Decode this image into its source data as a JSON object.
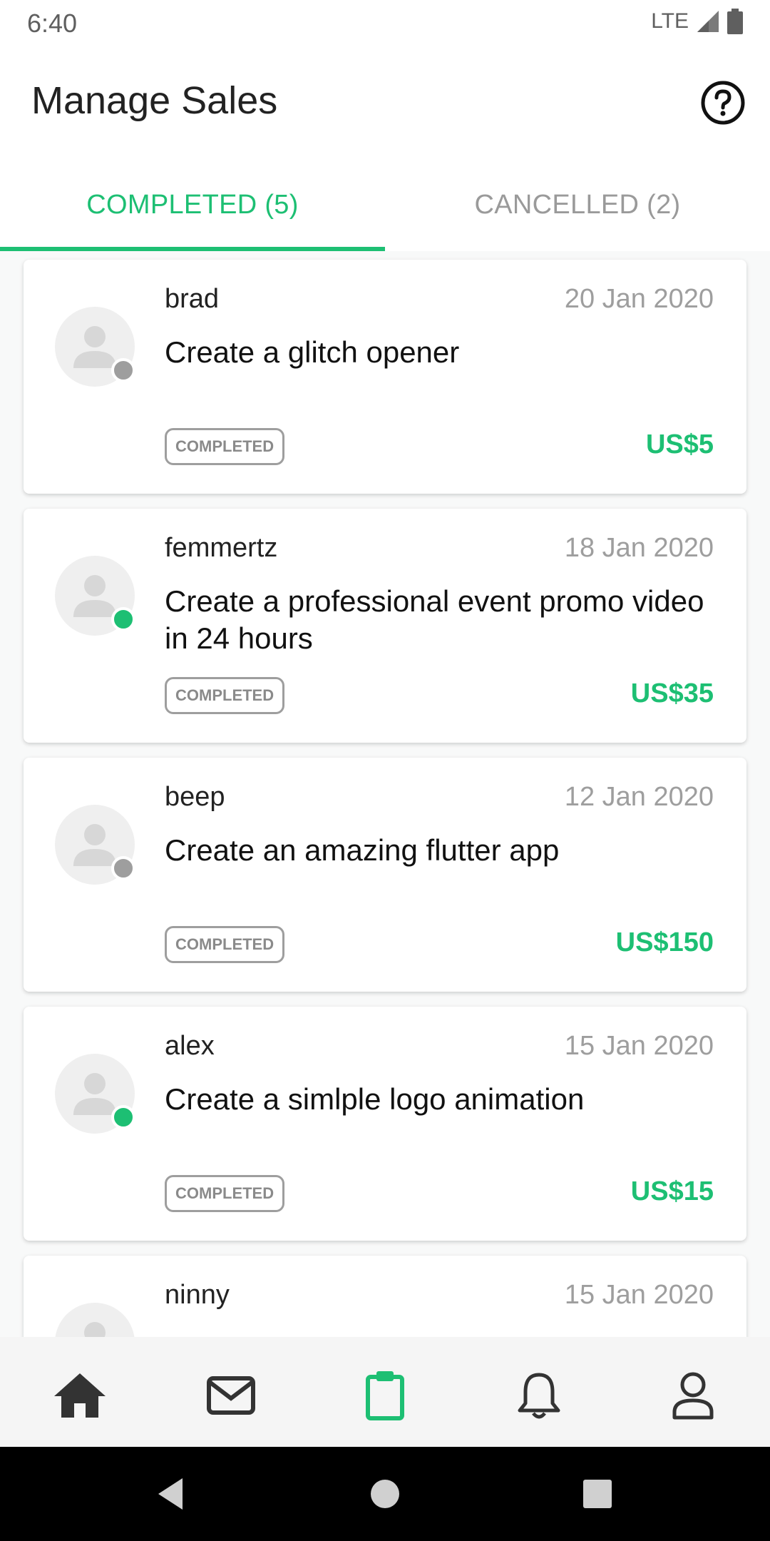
{
  "status_bar": {
    "time": "6:40",
    "network": "LTE"
  },
  "header": {
    "title": "Manage Sales",
    "help_icon": "help-circle-icon"
  },
  "tabs": [
    {
      "label": "COMPLETED (5)",
      "active": true
    },
    {
      "label": "CANCELLED (2)",
      "active": false
    }
  ],
  "colors": {
    "accent": "#1dbf73",
    "online": "#1dbf73",
    "offline": "#9e9e9e"
  },
  "orders": [
    {
      "username": "brad",
      "date": "20 Jan 2020",
      "title": "Create a glitch opener",
      "status": "COMPLETED",
      "price": "US$5",
      "online": false
    },
    {
      "username": "femmertz",
      "date": "18 Jan 2020",
      "title": "Create a professional event promo video in 24 hours",
      "status": "COMPLETED",
      "price": "US$35",
      "online": true
    },
    {
      "username": "beep",
      "date": "12 Jan 2020",
      "title": "Create an amazing flutter app",
      "status": "COMPLETED",
      "price": "US$150",
      "online": false
    },
    {
      "username": "alex",
      "date": "15 Jan 2020",
      "title": "Create a simlple logo animation",
      "status": "COMPLETED",
      "price": "US$15",
      "online": true
    },
    {
      "username": "ninny",
      "date": "15 Jan 2020"
    }
  ],
  "bottom_nav": [
    {
      "icon": "home-icon",
      "active": false
    },
    {
      "icon": "mail-icon",
      "active": false
    },
    {
      "icon": "clipboard-icon",
      "active": true
    },
    {
      "icon": "bell-icon",
      "active": false
    },
    {
      "icon": "profile-icon",
      "active": false
    }
  ]
}
